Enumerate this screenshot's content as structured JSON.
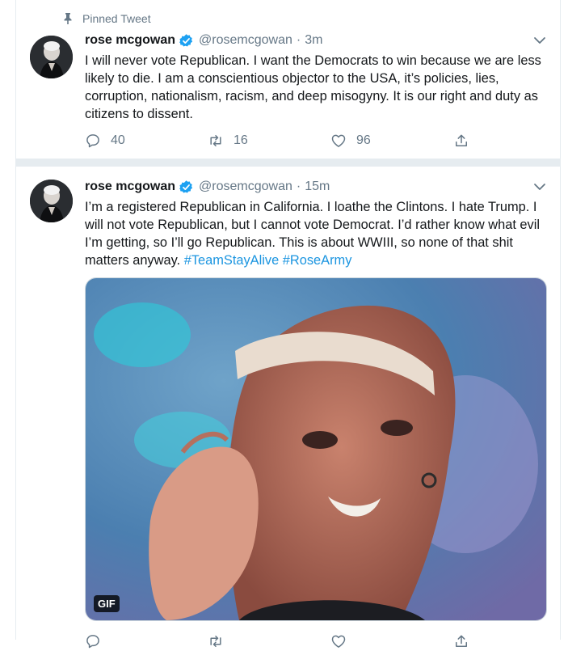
{
  "pinned_label": "Pinned Tweet",
  "colors": {
    "accent": "#1da1f2",
    "hashtag": "#1b95e0",
    "secondary_text": "#657786",
    "separator": "#e6ecf0"
  },
  "tweets": [
    {
      "display_name": "rose mcgowan",
      "handle": "@rosemcgowan",
      "separator": "·",
      "time": "3m",
      "text": "I will never vote Republican. I want the Democrats to win because we are less likely to die. I am a conscientious objector to the USA, it’s policies, lies, corruption, nationalism, racism, and deep misogyny. It is our right and duty as citizens to dissent.",
      "replies": "40",
      "retweets": "16",
      "likes": "96"
    },
    {
      "display_name": "rose mcgowan",
      "handle": "@rosemcgowan",
      "separator": "·",
      "time": "15m",
      "text": "I’m a registered Republican in California. I loathe the Clintons. I hate Trump. I will not vote Republican, but I cannot vote Democrat. I’d rather know what evil I’m getting, so I’ll go Republican. This is about WWIII, so none of that shit matters anyway.",
      "hashtags": [
        "#TeamStayAlive",
        "#RoseArmy"
      ],
      "media_badge": "GIF"
    }
  ],
  "icons": [
    "pin-icon",
    "verified-badge-icon",
    "chevron-down-icon",
    "reply-icon",
    "retweet-icon",
    "like-icon",
    "share-icon"
  ]
}
